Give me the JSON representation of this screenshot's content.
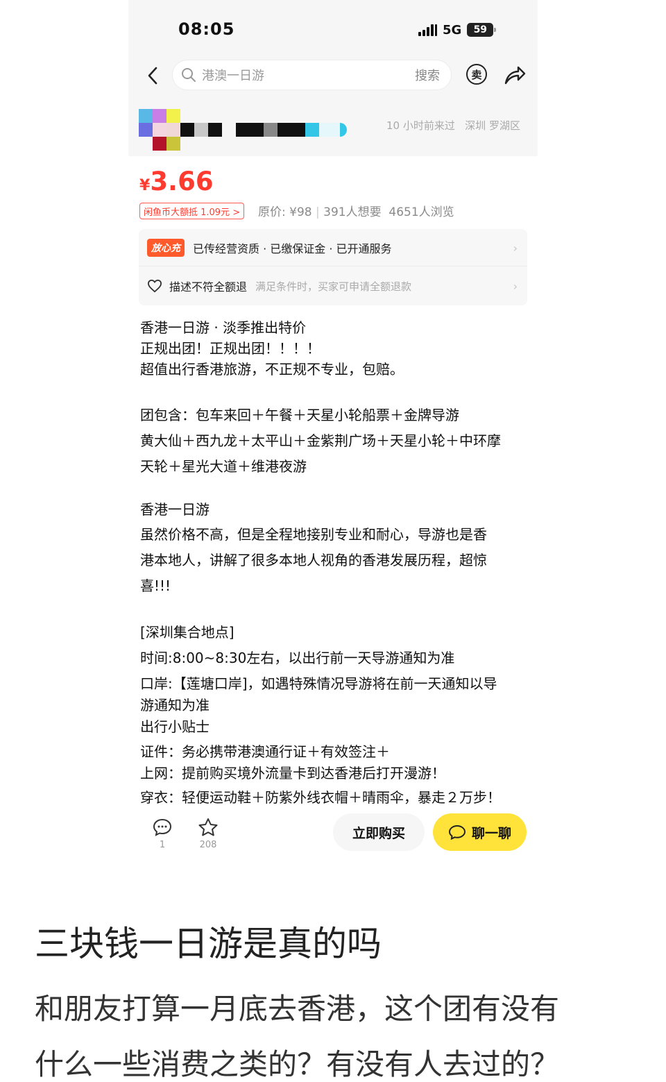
{
  "status_bar": {
    "time": "08:05",
    "network": "5G",
    "battery": "59"
  },
  "search": {
    "placeholder": "港澳一日游",
    "button": "搜索"
  },
  "header_icons": {
    "sell": "卖"
  },
  "seller": {
    "last_seen": "10 小时前来过",
    "location": "深圳 罗湖区"
  },
  "price": {
    "symbol": "¥",
    "amount": "3.66"
  },
  "coin_badge": "闲鱼币大额抵 1.09元 >",
  "stats": {
    "original_price": "原价: ¥98",
    "wants": "391人想要",
    "views": "4651人浏览"
  },
  "guarantee": {
    "tag": "放心充",
    "row1": "已传经营资质 · 已缴保证金 · 已开通服务",
    "row2_title": "描述不符全额退",
    "row2_sub": "满足条件时，买家可申请全额退款"
  },
  "description": [
    "香港一日游 · 淡季推出特价",
    "正规出团！正规出团！！！！",
    "超值出行香港旅游，不正规不专业，包赔。",
    "团包含：包车来回＋午餐＋天星小轮船票＋金牌导游",
    "黄大仙＋西九龙＋太平山＋金紫荆广场＋天星小轮＋中环摩",
    "天轮＋星光大道＋维港夜游",
    "香港一日游",
    "虽然价格不高，但是全程地接别专业和耐心，导游也是香",
    "港本地人，讲解了很多本地人视角的香港发展历程，超惊",
    "喜!!!",
    "[深圳集合地点]",
    "时间:8:00~8:30左右，以出行前一天导游通知为准",
    "口岸:【莲塘口岸]，如遇特殊情况导游将在前一天通知以导",
    "游通知为准",
    "出行小贴士",
    " 证件：务必携带港澳通行证＋有效签注＋",
    "上网：提前购买境外流量卡到达香港后打开漫游！",
    " 穿衣：轻便运动鞋＋防紫外线衣帽＋晴雨伞，暴走２万步！"
  ],
  "bottom_bar": {
    "comments": "1",
    "favorites": "208",
    "buy": "立即购买",
    "chat": "聊一聊"
  },
  "question": {
    "title": "三块钱一日游是真的吗",
    "body_line1": "和朋友打算一月底去香港，这个团有没有",
    "body_line2": "什么一些消费之类的？有没有人去过的？"
  }
}
